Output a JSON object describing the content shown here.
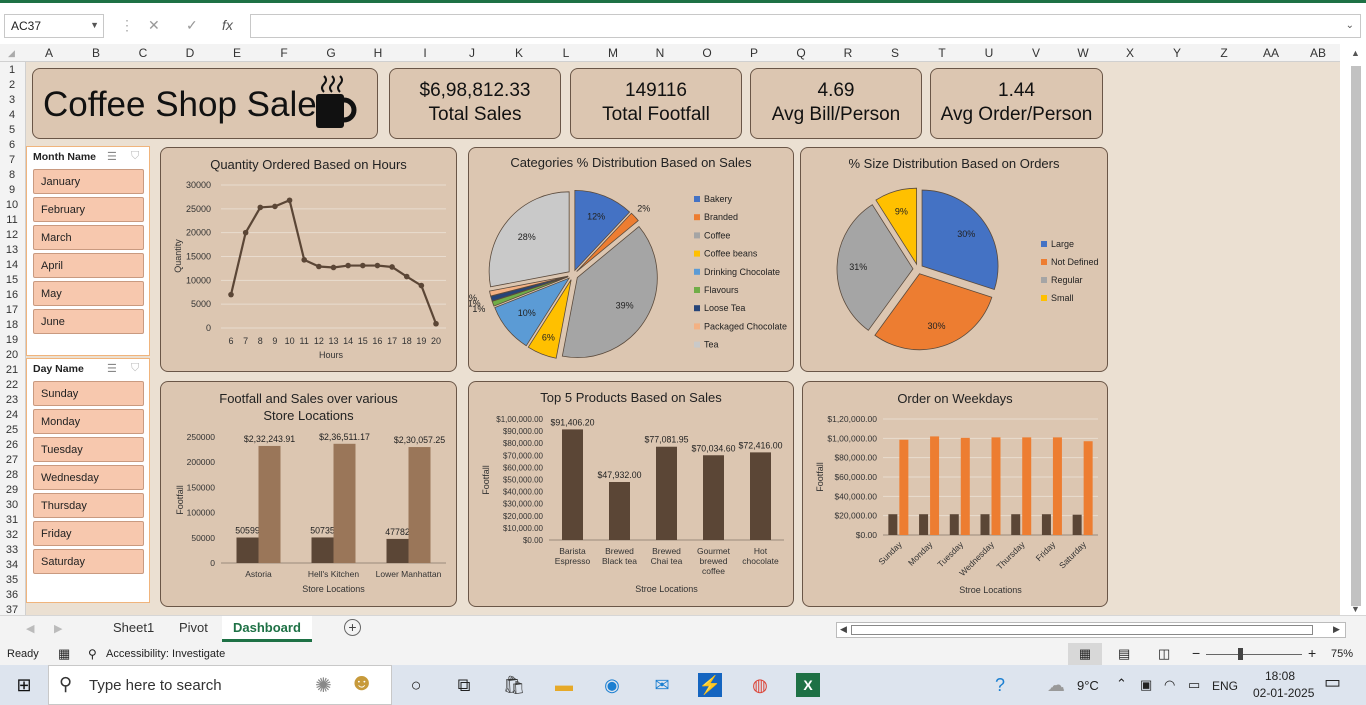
{
  "formula_bar": {
    "name_box": "AC37",
    "fx": "fx",
    "cancel": "✕",
    "enter": "✓",
    "formula": ""
  },
  "columns": [
    "A",
    "B",
    "C",
    "D",
    "E",
    "F",
    "G",
    "H",
    "I",
    "J",
    "K",
    "L",
    "M",
    "N",
    "O",
    "P",
    "Q",
    "R",
    "S",
    "T",
    "U",
    "V",
    "W",
    "X",
    "Y",
    "Z",
    "AA",
    "AB"
  ],
  "rows": [
    "1",
    "2",
    "3",
    "4",
    "5",
    "6",
    "7",
    "8",
    "9",
    "10",
    "11",
    "12",
    "13",
    "14",
    "15",
    "16",
    "17",
    "18",
    "19",
    "20",
    "21",
    "22",
    "23",
    "24",
    "25",
    "26",
    "27",
    "28",
    "29",
    "30",
    "31",
    "32",
    "33",
    "34",
    "35",
    "36",
    "37"
  ],
  "dashboard": {
    "title": "Coffee Shop Sales",
    "title_icon": "coffee-cup-icon",
    "kpis": [
      {
        "value": "$6,98,812.33",
        "label": "Total Sales"
      },
      {
        "value": "149116",
        "label": "Total Footfall"
      },
      {
        "value": "4.69",
        "label": "Avg Bill/Person"
      },
      {
        "value": "1.44",
        "label": "Avg Order/Person"
      }
    ]
  },
  "slicers": {
    "month": {
      "header": "Month Name",
      "items": [
        "January",
        "February",
        "March",
        "April",
        "May",
        "June"
      ]
    },
    "day": {
      "header": "Day Name",
      "items": [
        "Sunday",
        "Monday",
        "Tuesday",
        "Wednesday",
        "Thursday",
        "Friday",
        "Saturday"
      ]
    }
  },
  "chart_data": [
    {
      "type": "line",
      "title": "Quantity Ordered Based on Hours",
      "xlabel": "Hours",
      "ylabel": "Quantity",
      "x": [
        6,
        7,
        8,
        9,
        10,
        11,
        12,
        13,
        14,
        15,
        16,
        17,
        18,
        19,
        20
      ],
      "values": [
        7000,
        20000,
        25300,
        25500,
        26800,
        14300,
        12900,
        12700,
        13100,
        13100,
        13100,
        12800,
        10800,
        8900,
        900
      ],
      "ylim": [
        0,
        30000
      ],
      "yticks": [
        0,
        5000,
        10000,
        15000,
        20000,
        25000,
        30000
      ],
      "color": "#5b4636"
    },
    {
      "type": "pie",
      "title": "Categories % Distribution Based on Sales",
      "categories": [
        "Bakery",
        "Branded",
        "Coffee",
        "Coffee beans",
        "Drinking Chocolate",
        "Flavours",
        "Loose Tea",
        "Packaged Chocolate",
        "Tea"
      ],
      "values": [
        12,
        2,
        39,
        6,
        10,
        1,
        1,
        1,
        28
      ],
      "labels": [
        "12%",
        "2%",
        "39%",
        "6%",
        "10%",
        "1%",
        "1%",
        "1%",
        "28%"
      ],
      "colors": [
        "#4472c4",
        "#ed7d31",
        "#a5a5a5",
        "#ffc000",
        "#5b9bd5",
        "#70ad47",
        "#264478",
        "#f4b183",
        "#c9c9c9"
      ],
      "legend": "right"
    },
    {
      "type": "pie",
      "title": "% Size Distribution Based on Orders",
      "categories": [
        "Large",
        "Not Defined",
        "Regular",
        "Small"
      ],
      "values": [
        30,
        30,
        31,
        9
      ],
      "labels": [
        "30%",
        "30%",
        "31%",
        "9%"
      ],
      "colors": [
        "#4472c4",
        "#ed7d31",
        "#a5a5a5",
        "#ffc000"
      ],
      "legend": "right"
    },
    {
      "type": "bar",
      "title": "Footfall and Sales over various Store Locations",
      "xlabel": "Store Locations",
      "ylabel": "Footfall",
      "categories": [
        "Astoria",
        "Hell's Kitchen",
        "Lower Manhattan"
      ],
      "series": [
        {
          "values": [
            50599,
            50735,
            47782
          ],
          "labels": [
            "50599",
            "50735",
            "47782"
          ],
          "color": "#5b4636"
        },
        {
          "values": [
            232244,
            236511,
            230057
          ],
          "labels": [
            "$2,32,243.91",
            "$2,36,511.17",
            "$2,30,057.25"
          ],
          "color": "#9a7659"
        }
      ],
      "ylim": [
        0,
        250000
      ],
      "yticks": [
        0,
        50000,
        100000,
        150000,
        200000,
        250000
      ]
    },
    {
      "type": "bar",
      "title": "Top 5 Products Based on Sales",
      "xlabel": "Stroe Locations",
      "ylabel": "Footfall",
      "categories": [
        "Barista Espresso",
        "Brewed Black tea",
        "Brewed Chai tea",
        "Gourmet brewed coffee",
        "Hot chocolate"
      ],
      "values": [
        91406.2,
        47932.0,
        77081.95,
        70034.6,
        72416.0
      ],
      "labels": [
        "$91,406.20",
        "$47,932.00",
        "$77,081.95",
        "$70,034.60",
        "$72,416.00"
      ],
      "ylim": [
        0,
        100000
      ],
      "yticks": [
        "$0.00",
        "$10,000.00",
        "$20,000.00",
        "$30,000.00",
        "$40,000.00",
        "$50,000.00",
        "$60,000.00",
        "$70,000.00",
        "$80,000.00",
        "$90,000.00",
        "$1,00,000.00"
      ],
      "color": "#5b4636"
    },
    {
      "type": "bar",
      "title": "Order on Weekdays",
      "xlabel": "Stroe Locations",
      "ylabel": "Footfall",
      "categories": [
        "Sunday",
        "Monday",
        "Tuesday",
        "Wednesday",
        "Thursday",
        "Friday",
        "Saturday"
      ],
      "series": [
        {
          "values": [
            21500,
            21500,
            21500,
            21500,
            21500,
            21500,
            21000
          ],
          "color": "#5b4636"
        },
        {
          "values": [
            98500,
            102000,
            100500,
            101000,
            101000,
            101000,
            97000
          ],
          "color": "#ed7d31"
        }
      ],
      "ylim": [
        0,
        120000
      ],
      "yticks": [
        "$0.00",
        "$20,000.00",
        "$40,000.00",
        "$60,000.00",
        "$80,000.00",
        "$1,00,000.00",
        "$1,20,000.00"
      ]
    }
  ],
  "tabs": [
    "Sheet1",
    "Pivot",
    "Dashboard"
  ],
  "status": {
    "ready": "Ready",
    "accessibility": "Accessibility: Investigate",
    "zoom": "75%"
  },
  "taskbar": {
    "search": "Type here to search",
    "weather": "9°C",
    "lang": "ENG",
    "time": "18:08",
    "date": "02-01-2025"
  }
}
